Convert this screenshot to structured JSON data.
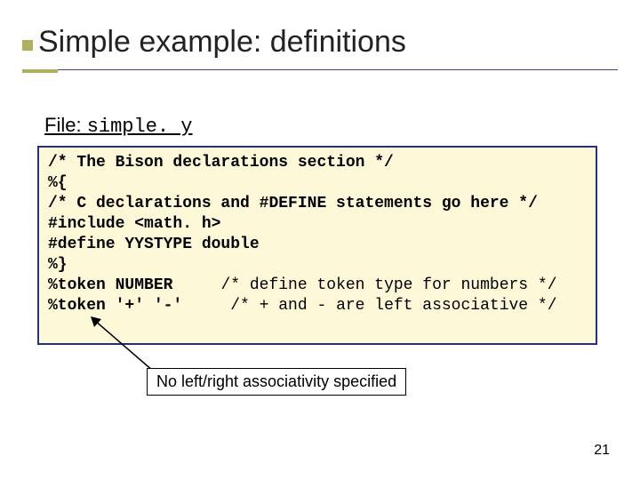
{
  "title": "Simple example: definitions",
  "file_prefix": "File: ",
  "file_name": "simple. y",
  "code": {
    "l1": "/* The Bison declarations section */",
    "l2": "%{",
    "l3": "/* C declarations and #DEFINE statements go here */",
    "l4": "#include <math. h>",
    "l5": "#define YYSTYPE double",
    "l6": "%}",
    "l7a": "%token NUMBER",
    "l7b": "     /* define token type for numbers */",
    "l8a": "%token '+' '-'",
    "l8b": "     /* + and - are left associative */"
  },
  "annotation": "No left/right associativity specified",
  "page_number": "21"
}
